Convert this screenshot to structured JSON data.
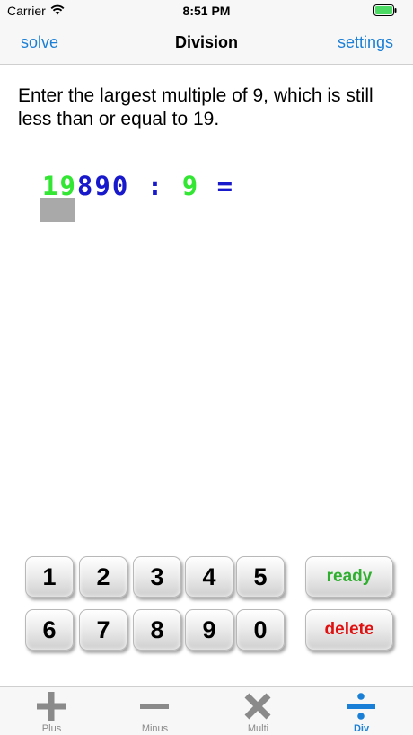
{
  "status_bar": {
    "carrier": "Carrier",
    "time": "8:51 PM"
  },
  "nav": {
    "left": "solve",
    "title": "Division",
    "right": "settings"
  },
  "prompt": "Enter the largest multiple of 9, which is still less than or equal to 19.",
  "equation": {
    "dividend_highlight": "19",
    "dividend_rest": "890",
    "operator": " : ",
    "divisor": "9",
    "equals": " ="
  },
  "keypad": {
    "row1": [
      "1",
      "2",
      "3",
      "4",
      "5"
    ],
    "row2": [
      "6",
      "7",
      "8",
      "9",
      "0"
    ],
    "ready": "ready",
    "delete": "delete"
  },
  "tabs": [
    {
      "label": "Plus",
      "icon": "plus-icon"
    },
    {
      "label": "Minus",
      "icon": "minus-icon"
    },
    {
      "label": "Multi",
      "icon": "multiply-icon"
    },
    {
      "label": "Div",
      "icon": "divide-icon",
      "active": true
    }
  ],
  "colors": {
    "accent": "#1a7fd6",
    "highlight_digits": "#33e633",
    "digits": "#1919cc",
    "ready": "#2fae2f",
    "delete": "#e01010",
    "tab_inactive": "#8a8a8a"
  }
}
